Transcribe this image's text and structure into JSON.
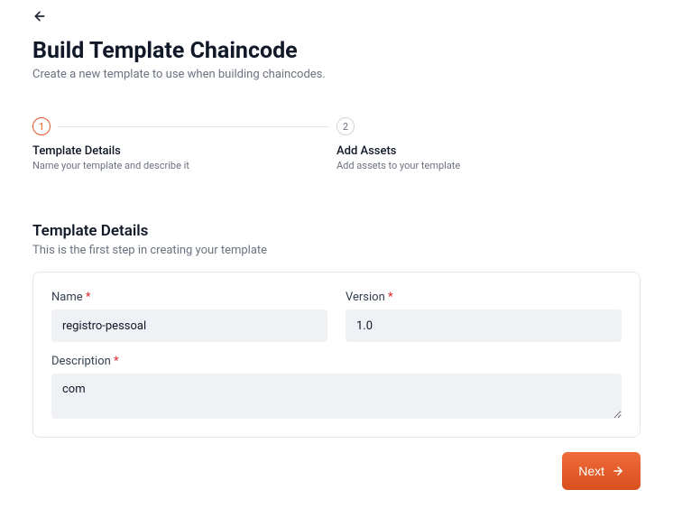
{
  "header": {
    "title": "Build Template Chaincode",
    "subtitle": "Create a new template to use when building chaincodes."
  },
  "stepper": {
    "steps": [
      {
        "number": "1",
        "title": "Template Details",
        "description": "Name your template and describe it",
        "active": true
      },
      {
        "number": "2",
        "title": "Add Assets",
        "description": "Add assets to your template",
        "active": false
      }
    ]
  },
  "section": {
    "title": "Template Details",
    "description": "This is the first step in creating your template"
  },
  "form": {
    "name": {
      "label": "Name",
      "value": "registro-pessoal"
    },
    "version": {
      "label": "Version",
      "value": "1.0"
    },
    "description": {
      "label": "Description",
      "value": "com"
    }
  },
  "footer": {
    "next_label": "Next"
  }
}
